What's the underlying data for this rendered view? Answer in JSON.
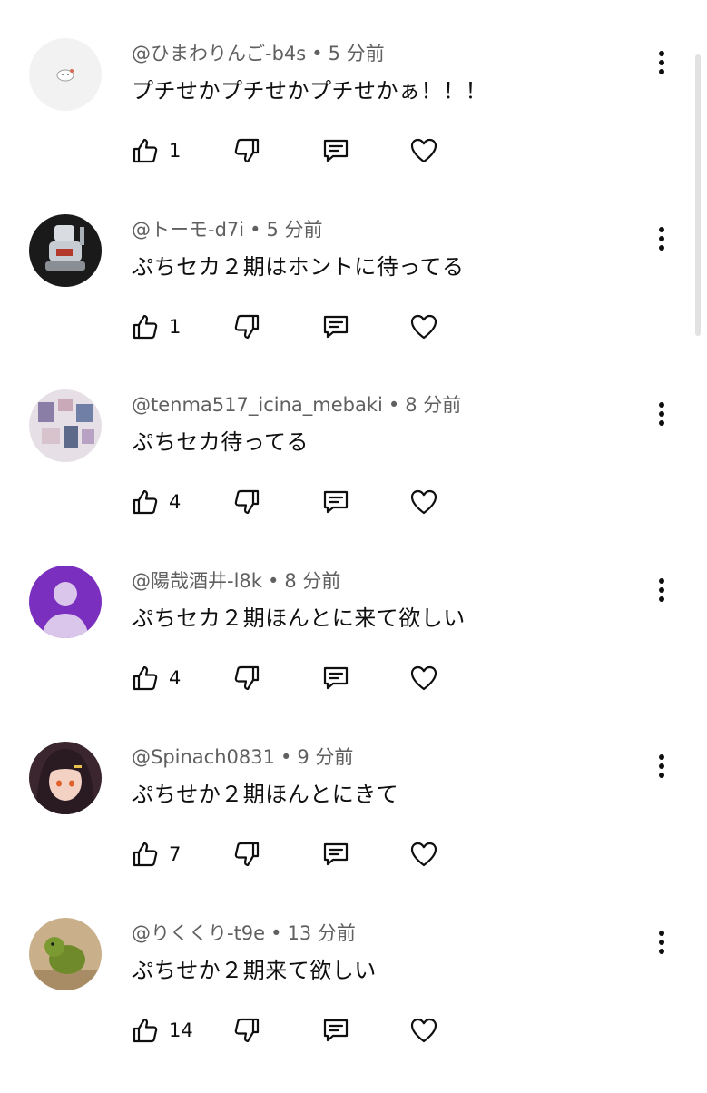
{
  "comments": [
    {
      "author": "@ひまわりんご-b4s",
      "separator": "•",
      "time": "5 分前",
      "text": "プチせかプチせかプチせかぁ！！！",
      "likes": "1",
      "avatar_icon": "hamster-avatar-icon",
      "avatar_bg": "#f2f2f2"
    },
    {
      "author": "@トーモ-d7i",
      "separator": "•",
      "time": "5 分前",
      "text": "ぷちセカ２期はホントに待ってる",
      "likes": "1",
      "avatar_icon": "robot-figure-avatar-icon",
      "avatar_bg": "#1a1a1a"
    },
    {
      "author": "@tenma517_icina_mebaki",
      "separator": "•",
      "time": "8 分前",
      "text": "ぷちセカ待ってる",
      "likes": "4",
      "avatar_icon": "photo-collage-avatar-icon",
      "avatar_bg": "#e7dfe6"
    },
    {
      "author": "@陽哉酒井-l8k",
      "separator": "•",
      "time": "8 分前",
      "text": "ぷちセカ２期ほんとに来て欲しい",
      "likes": "4",
      "avatar_icon": "default-user-avatar-icon",
      "avatar_bg": "#7b2fbf"
    },
    {
      "author": "@Spinach0831",
      "separator": "•",
      "time": "9 分前",
      "text": "ぷちせか２期ほんとにきて",
      "likes": "7",
      "avatar_icon": "anime-girl-avatar-icon",
      "avatar_bg": "#3b2630"
    },
    {
      "author": "@りくくり-t9e",
      "separator": "•",
      "time": "13 分前",
      "text": "ぷちせか２期来て欲しい",
      "likes": "14",
      "avatar_icon": "parrot-avatar-icon",
      "avatar_bg": "#c9b08a"
    }
  ]
}
